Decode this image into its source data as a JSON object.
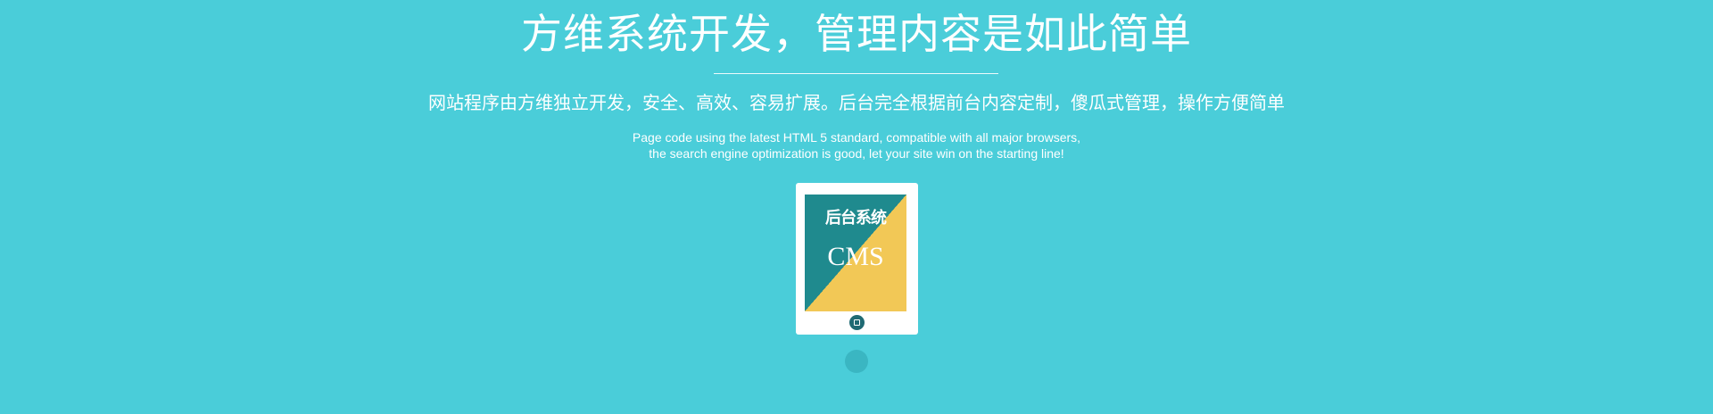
{
  "hero": {
    "title": "方维系统开发，管理内容是如此简单",
    "subtitle_cn": "网站程序由方维独立开发，安全、高效、容易扩展。后台完全根据前台内容定制，傻瓜式管理，操作方便简单",
    "subtitle_en_line1": "Page code using the latest HTML 5 standard, compatible with all major browsers,",
    "subtitle_en_line2": "the search engine optimization is good, let your site win on the starting line!"
  },
  "device": {
    "screen_title": "后台系统",
    "screen_label": "CMS",
    "home_icon": "home-button-icon"
  },
  "pager": {
    "active_index": 1,
    "count": 1
  },
  "colors": {
    "background": "#4acdd9",
    "screen_teal": "#1f8a8e",
    "screen_yellow": "#f2c856",
    "home_button": "#1f6a73",
    "pager_dot": "#3ab6c2",
    "text": "#ffffff"
  }
}
